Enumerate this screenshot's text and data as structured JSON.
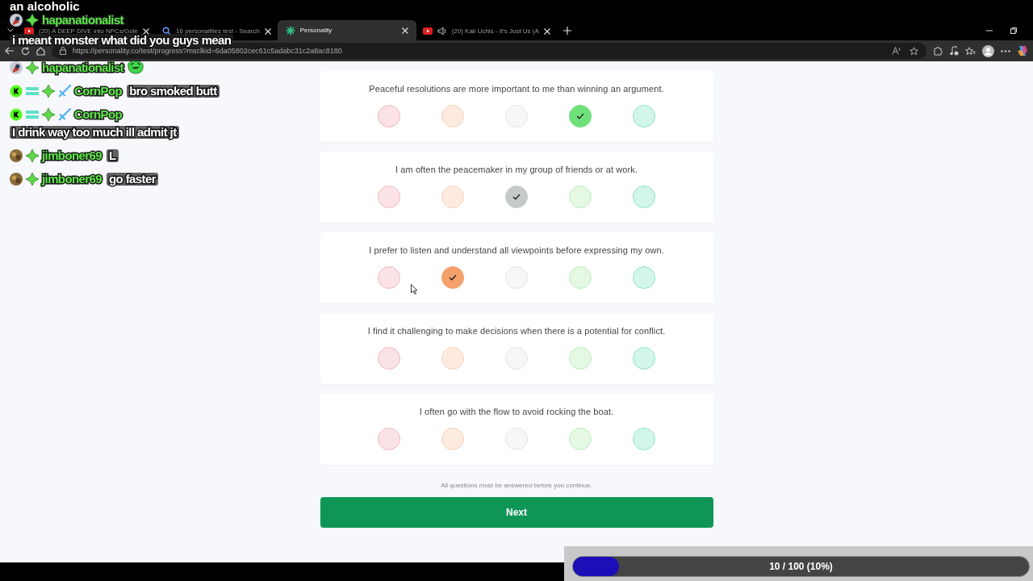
{
  "stream_caption": "an alcoholic",
  "browser": {
    "tabs": [
      {
        "title": "(20) A DEEP DIVE into NPCs/Gole",
        "kind": "video",
        "selected": false
      },
      {
        "title": "16 personalities test - Search",
        "kind": "search",
        "selected": false
      },
      {
        "title": "Personality",
        "kind": "site",
        "selected": true
      },
      {
        "title": "(20) Kali Uchis - It's Just Us (A",
        "kind": "video",
        "audio": true,
        "selected": false
      }
    ],
    "url": "https://personality.co/test/progress?msclkid=6da05802cec61c5adabc31c2a8ac8180"
  },
  "questions": [
    {
      "text": "Peaceful resolutions are more important to me than winning an argument.",
      "options": [
        {
          "selected": false
        },
        {
          "selected": false
        },
        {
          "selected": false
        },
        {
          "selected": true
        },
        {
          "selected": false
        }
      ]
    },
    {
      "text": "I am often the peacemaker in my group of friends or at work.",
      "options": [
        {
          "selected": false
        },
        {
          "selected": false
        },
        {
          "selected": true
        },
        {
          "selected": false
        },
        {
          "selected": false
        }
      ]
    },
    {
      "text": "I prefer to listen and understand all viewpoints before expressing my own.",
      "options": [
        {
          "selected": false
        },
        {
          "selected": true
        },
        {
          "selected": false
        },
        {
          "selected": false
        },
        {
          "selected": false
        }
      ]
    },
    {
      "text": "I find it challenging to make decisions when there is a potential for conflict.",
      "options": [
        {
          "selected": false
        },
        {
          "selected": false
        },
        {
          "selected": false
        },
        {
          "selected": false
        },
        {
          "selected": false
        }
      ]
    },
    {
      "text": "I often go with the flow to avoid rocking the boat.",
      "options": [
        {
          "selected": false
        },
        {
          "selected": false
        },
        {
          "selected": false
        },
        {
          "selected": false
        },
        {
          "selected": false
        }
      ]
    }
  ],
  "note": "All questions must be answered before you continue.",
  "next_button": "Next",
  "chat": [
    {
      "user": "hapanationalist",
      "badges": [
        {
          "kind": "avatar"
        },
        {
          "kind": "gem"
        }
      ],
      "message": "i meant monster what did you guys mean"
    },
    {
      "user": "hapanationalist",
      "badges": [
        {
          "kind": "avatar"
        },
        {
          "kind": "gem"
        }
      ],
      "emote": true
    },
    {
      "user": "CornPop",
      "badges": [
        {
          "kind": "kick"
        },
        {
          "kind": "bars"
        },
        {
          "kind": "gem"
        },
        {
          "kind": "sword"
        }
      ],
      "message": "bro smoked butt"
    },
    {
      "user": "CornPop",
      "badges": [
        {
          "kind": "kick"
        },
        {
          "kind": "bars"
        },
        {
          "kind": "gem"
        },
        {
          "kind": "sword"
        }
      ],
      "message": "I drink way too much ill admit jt"
    },
    {
      "user": "jimboner69",
      "badges": [
        {
          "kind": "avatar2"
        },
        {
          "kind": "gem"
        }
      ],
      "message": "L"
    },
    {
      "user": "jimboner69",
      "badges": [
        {
          "kind": "avatar2"
        },
        {
          "kind": "gem"
        }
      ],
      "message": "go faster"
    }
  ],
  "progress": {
    "label": "10 / 100 (10%)",
    "level": 0.1
  }
}
